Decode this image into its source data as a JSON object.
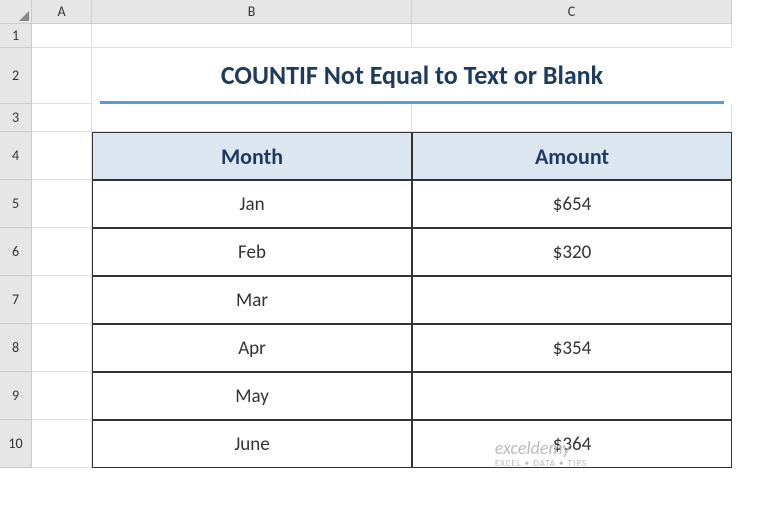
{
  "columns": [
    "A",
    "B",
    "C"
  ],
  "rows": [
    "1",
    "2",
    "3",
    "4",
    "5",
    "6",
    "7",
    "8",
    "9",
    "10"
  ],
  "title": "COUNTIF Not Equal to Text or Blank",
  "table": {
    "headers": {
      "month": "Month",
      "amount": "Amount"
    },
    "data": [
      {
        "month": "Jan",
        "amount": "$654"
      },
      {
        "month": "Feb",
        "amount": "$320"
      },
      {
        "month": "Mar",
        "amount": ""
      },
      {
        "month": "Apr",
        "amount": "$354"
      },
      {
        "month": "May",
        "amount": ""
      },
      {
        "month": "June",
        "amount": "$364"
      }
    ]
  },
  "watermark": {
    "brand": "exceldemy",
    "tagline": "EXCEL • DATA • TIPS"
  },
  "chart_data": {
    "type": "table",
    "title": "COUNTIF Not Equal to Text or Blank",
    "columns": [
      "Month",
      "Amount"
    ],
    "rows": [
      [
        "Jan",
        "$654"
      ],
      [
        "Feb",
        "$320"
      ],
      [
        "Mar",
        ""
      ],
      [
        "Apr",
        "$354"
      ],
      [
        "May",
        ""
      ],
      [
        "June",
        "$364"
      ]
    ]
  }
}
